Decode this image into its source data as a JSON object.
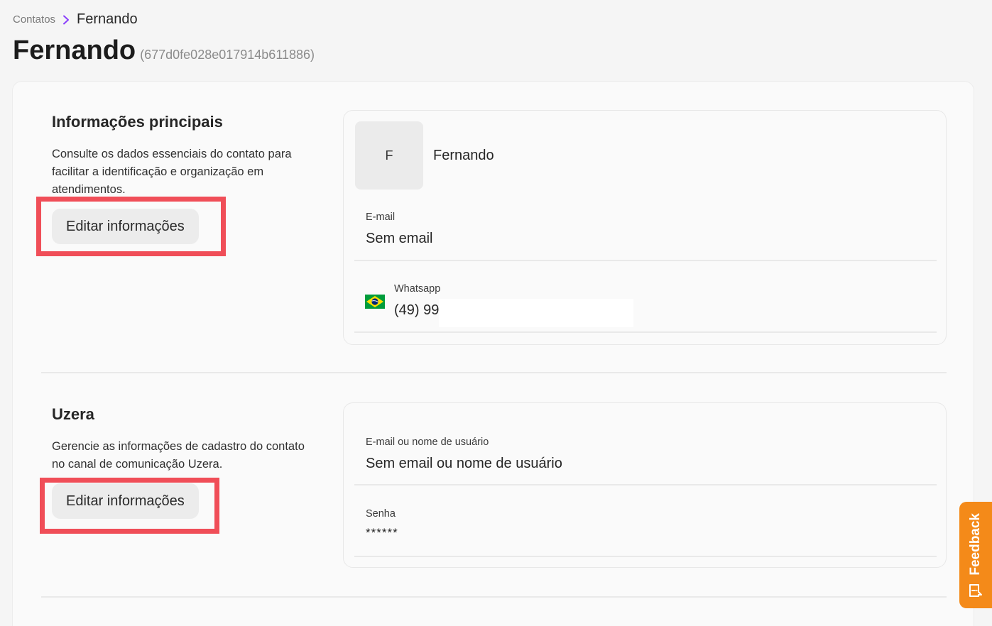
{
  "breadcrumb": {
    "parent": "Contatos",
    "current": "Fernando"
  },
  "header": {
    "title": "Fernando",
    "id": "(677d0fe028e017914b611886)"
  },
  "main_info": {
    "title": "Informações principais",
    "description": "Consulte os dados essenciais do contato para facilitar a identificação e organização em atendimentos.",
    "edit_label": "Editar informações",
    "avatar_initial": "F",
    "contact_name": "Fernando",
    "email_label": "E-mail",
    "email_value": "Sem email",
    "whatsapp_label": "Whatsapp",
    "whatsapp_value": "(49) 99"
  },
  "uzera": {
    "title": "Uzera",
    "description": "Gerencie as informações de cadastro do contato no canal de comunicação Uzera.",
    "edit_label": "Editar informações",
    "username_label": "E-mail ou nome de usuário",
    "username_value": "Sem email ou nome de usuário",
    "password_label": "Senha",
    "password_value": "******"
  },
  "feedback": {
    "label": "Feedback"
  },
  "colors": {
    "accent_purple": "#8a3ffc",
    "highlight_red": "#f04e58",
    "feedback_orange": "#f48a19"
  },
  "icons": {
    "breadcrumb_separator": "chevron-right-icon",
    "whatsapp_flag": "brazil-flag-icon",
    "feedback": "chat-feedback-icon"
  }
}
